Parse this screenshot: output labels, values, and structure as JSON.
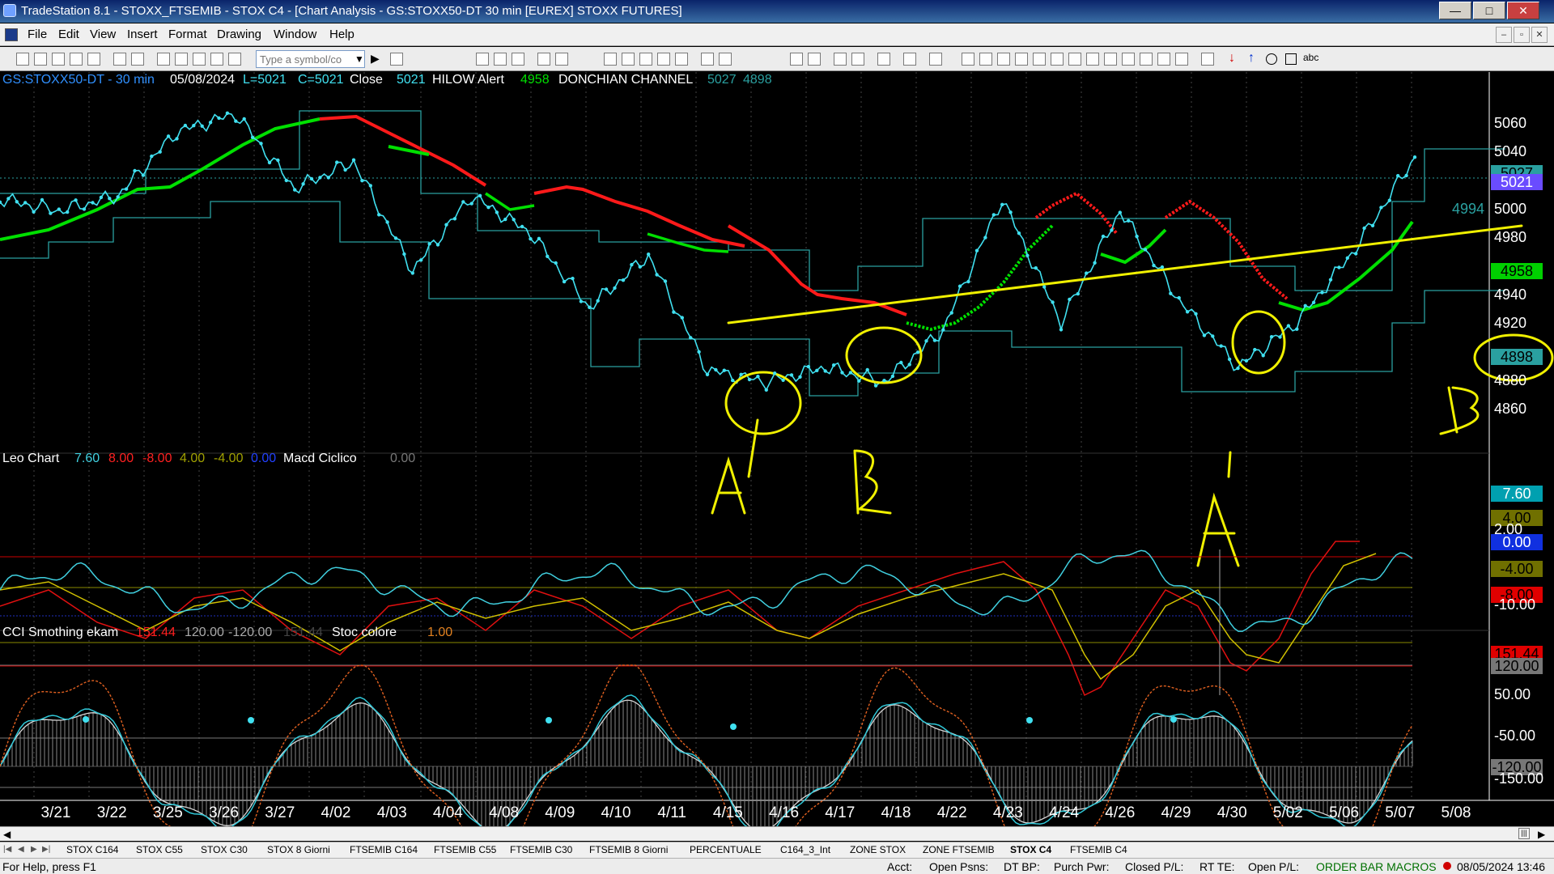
{
  "window": {
    "title": "TradeStation 8.1 - STOXX_FTSEMIB - STOX  C4 - [Chart Analysis - GS:STOXX50-DT  30 min  [EUREX] STOXX FUTURES]"
  },
  "menu": [
    "File",
    "Edit",
    "View",
    "Insert",
    "Format",
    "Drawing",
    "Window",
    "Help"
  ],
  "toolbar": {
    "symbol_placeholder": "Type a symbol/co"
  },
  "price_header": {
    "symbol": "GS:STOXX50-DT - 30 min",
    "date": "05/08/2024",
    "low": "L=5021",
    "close": "C=5021",
    "close_label": "Close",
    "close_value": "5021",
    "hilow": "HILOW Alert",
    "hilow_value": "4958",
    "donchian": "DONCHIAN CHANNEL",
    "don_upper": "5027",
    "don_lower": "4898"
  },
  "osc_header": {
    "name": "Leo Chart",
    "v1": "7.60",
    "v2": "8.00",
    "v3": "-8.00",
    "v4": "4.00",
    "v5": "-4.00",
    "v6": "0.00",
    "macd": "Macd Ciclico",
    "macd_value": "0.00"
  },
  "cci_header": {
    "name": "CCI Smothing ekam",
    "v1": "151.44",
    "v2": "120.00",
    "v3": "-120.00",
    "v4": "151.44",
    "stoc": "Stoc colore",
    "stoc_value": "1.00"
  },
  "price_axis": [
    "5060",
    "5040",
    "5000",
    "4980",
    "4940",
    "4920",
    "4880",
    "4860"
  ],
  "price_badges": {
    "top": "5027",
    "last": "5021",
    "hilow": "4958",
    "lower": "4898",
    "level": "4994"
  },
  "osc_axis": [
    "2.00",
    "-10.00"
  ],
  "osc_badges": {
    "a": "7.60",
    "b": "4.00",
    "c": "0.00",
    "d": "-4.00",
    "e": "-8.00"
  },
  "cci_axis": [
    "50.00",
    "-50.00",
    "-150.00"
  ],
  "cci_badges": {
    "a": "151.44",
    "b": "120.00",
    "c": "-120.00"
  },
  "x_axis": [
    "3/21",
    "3/22",
    "3/25",
    "3/26",
    "3/27",
    "4/02",
    "4/03",
    "4/04",
    "4/08",
    "4/09",
    "4/10",
    "4/11",
    "4/15",
    "4/16",
    "4/17",
    "4/18",
    "4/22",
    "4/23",
    "4/24",
    "4/26",
    "4/29",
    "4/30",
    "5/02",
    "5/06",
    "5/07",
    "5/08"
  ],
  "annotations": [
    "A",
    "B",
    "A",
    "B"
  ],
  "tabs": [
    "STOX C164",
    "STOX C55",
    "STOX  C30",
    "STOX  8 Giorni",
    "FTSEMIB C164",
    "FTSEMIB C55",
    "FTSEMIB C30",
    "FTSEMIB  8 Giorni",
    "PERCENTUALE",
    "C164_3_Int",
    "ZONE STOX",
    "ZONE FTSEMIB",
    "STOX  C4",
    "FTSEMIB C4"
  ],
  "status": {
    "help": "For Help, press F1",
    "acct": "Acct:",
    "open_psns": "Open Psns:",
    "dt_bp": "DT BP:",
    "purch_pwr": "Purch Pwr:",
    "closed_pl": "Closed P/L:",
    "rt_te": "RT TE:",
    "open_pl": "Open P/L:",
    "macros": "ORDER BAR  MACROS",
    "datetime": "08/05/2024 13:46"
  },
  "colors": {
    "price": "#40e0f0",
    "up_line": "#00e000",
    "down_line": "#ff1a1a",
    "donchian": "#2aa0a0",
    "annotation": "#f0f000"
  },
  "chart_data": {
    "type": "line",
    "title": "GS:STOXX50-DT - 30 min",
    "x": [
      "3/21",
      "3/22",
      "3/25",
      "3/26",
      "3/27",
      "4/02",
      "4/03",
      "4/04",
      "4/08",
      "4/09",
      "4/10",
      "4/11",
      "4/15",
      "4/16",
      "4/17",
      "4/18",
      "4/22",
      "4/23",
      "4/24",
      "4/26",
      "4/29",
      "4/30",
      "5/02",
      "5/06",
      "5/07"
    ],
    "series": [
      {
        "values": [
          4993,
          4985,
          4995,
          5038,
          5050,
          5000,
          5018,
          4945,
          4995,
          4970,
          4920,
          4955,
          4878,
          4870,
          4880,
          4870,
          4905,
          4993,
          4910,
          4985,
          4925,
          4880,
          4910,
          4960,
          5021
        ]
      }
    ],
    "ylim": [
      4850,
      5070
    ]
  }
}
